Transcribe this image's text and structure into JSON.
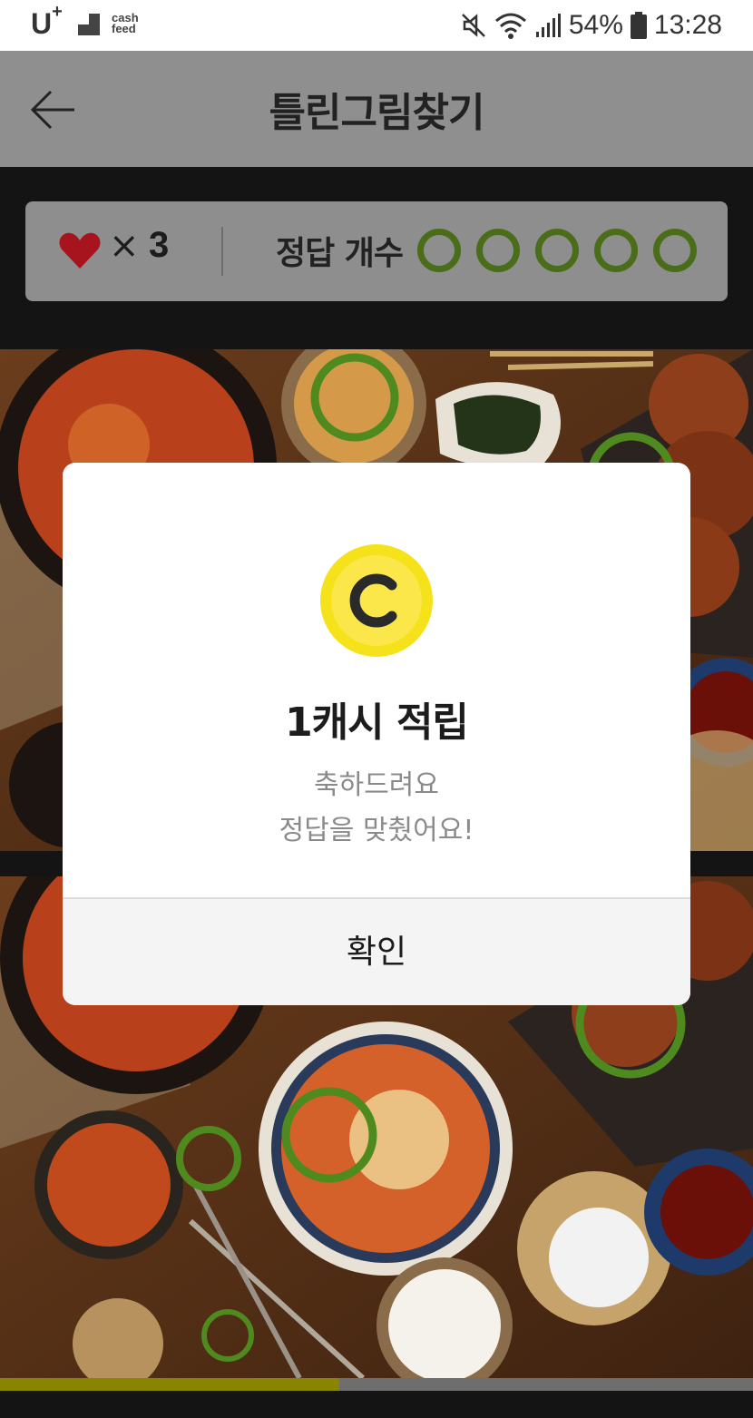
{
  "status_bar": {
    "carrier": "U",
    "carrier_plus": "+",
    "app_brand_line1": "cash",
    "app_brand_line2": "feed",
    "battery": "54%",
    "time": "13:28"
  },
  "header": {
    "title": "틀린그림찾기"
  },
  "game_info": {
    "lives_symbol": "×",
    "lives": "3",
    "answers_label": "정답 개수",
    "answer_slots": 5,
    "slot_color": "#4a6d1a"
  },
  "progress": {
    "fraction": 0.45,
    "color": "#8a8500"
  },
  "dialog": {
    "coin_letter": "C",
    "reward": "1캐시 적립",
    "message_line1": "축하드려요",
    "message_line2": "정답을 맞췄어요!",
    "confirm_label": "확인"
  },
  "colors": {
    "accent_yellow": "#f5e21a",
    "found_circle": "#4f8a1f"
  }
}
